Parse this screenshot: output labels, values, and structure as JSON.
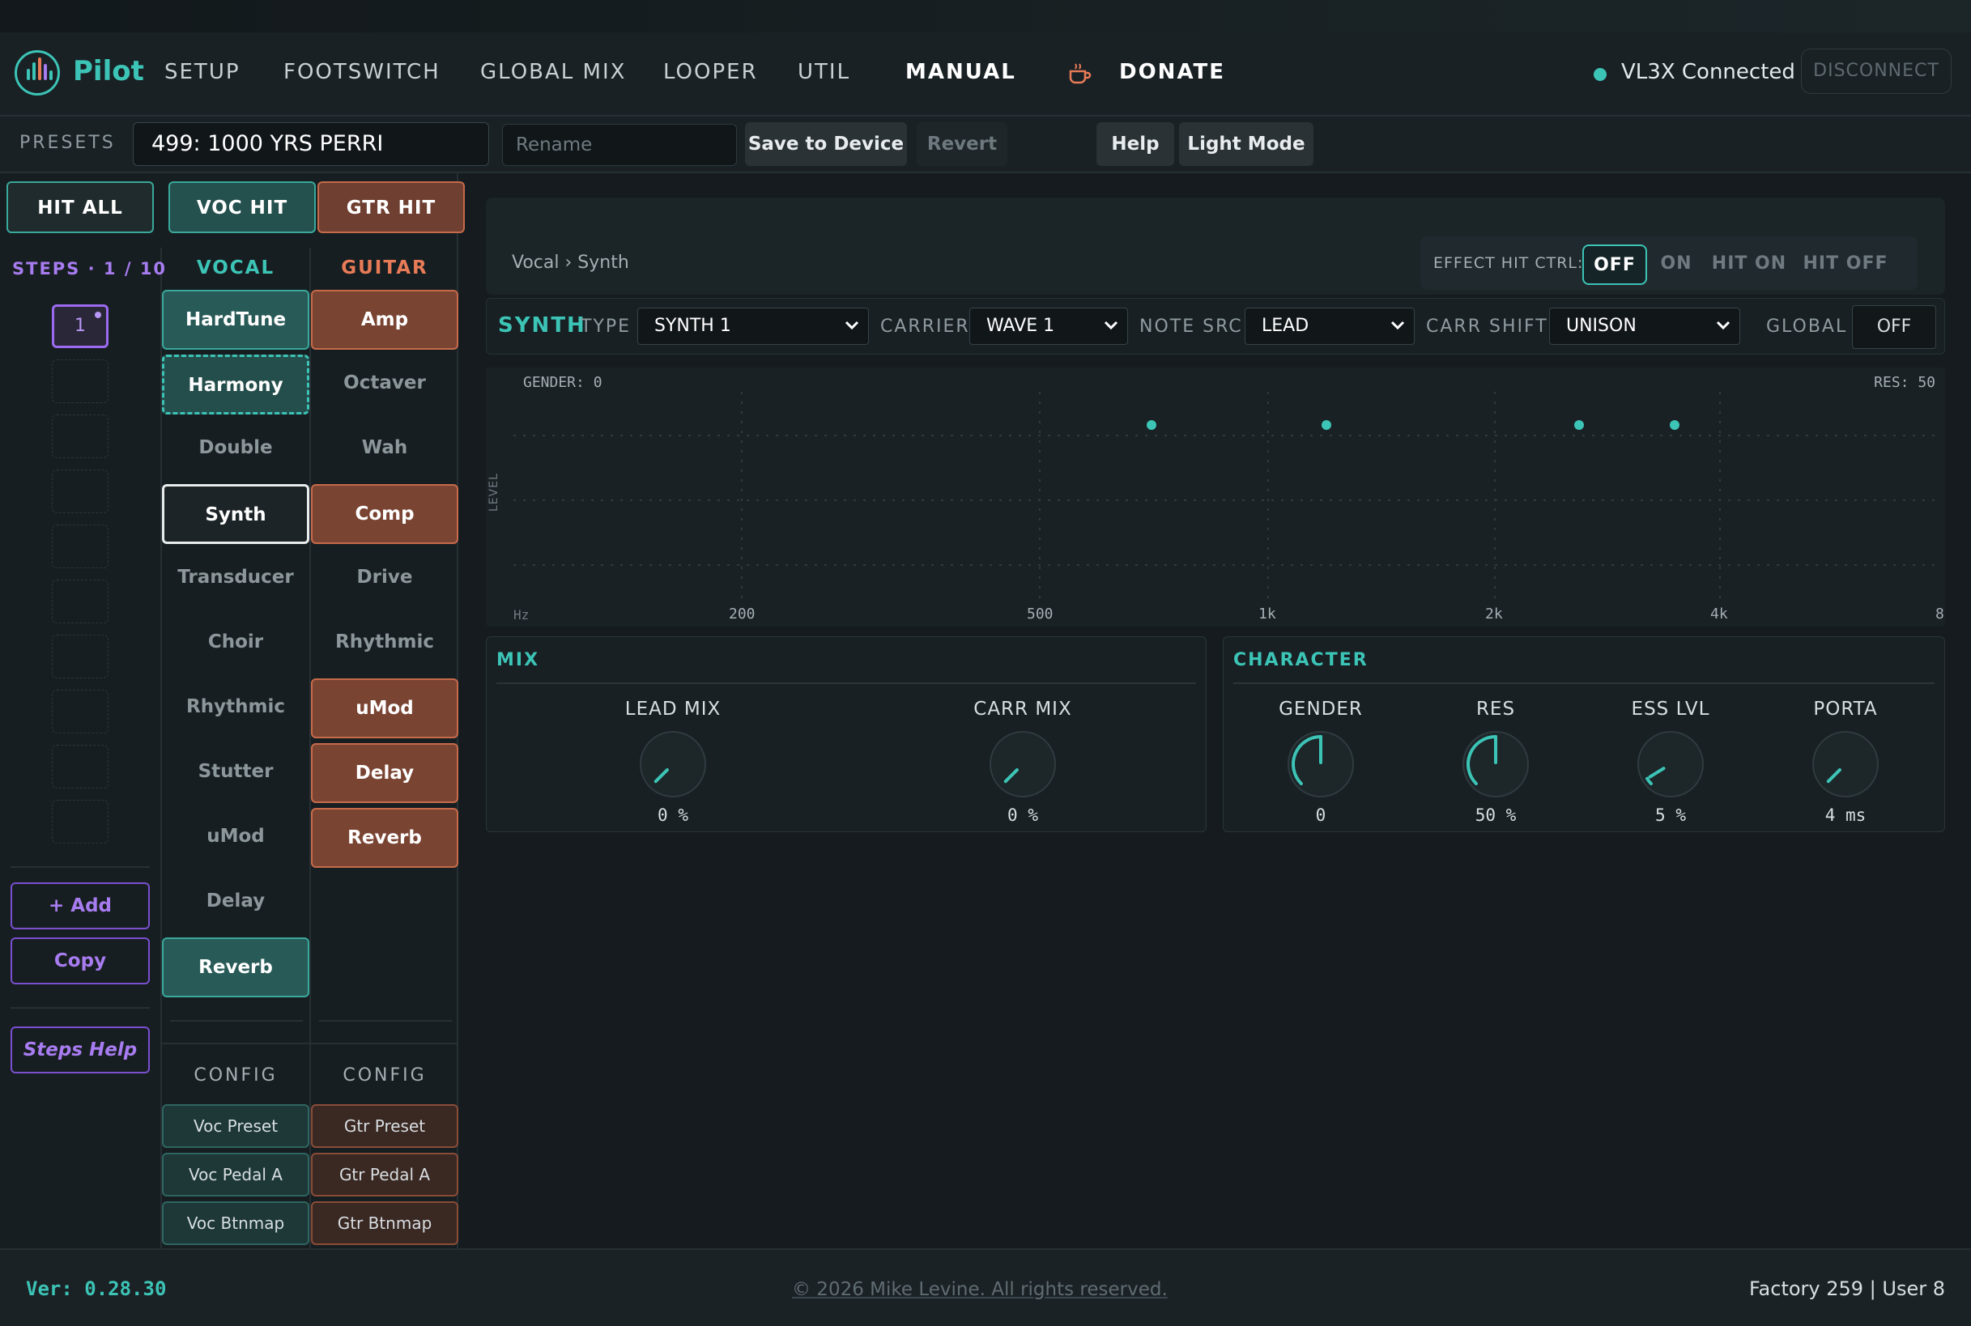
{
  "app": {
    "name": "Pilot",
    "accent": "#3cc4b6"
  },
  "nav": {
    "items": [
      "SETUP",
      "FOOTSWITCH",
      "GLOBAL MIX",
      "LOOPER",
      "UTIL",
      "MANUAL"
    ],
    "active": "MANUAL",
    "donate": "DONATE",
    "connection_status": "VL3X Connected",
    "disconnect": "DISCONNECT"
  },
  "presets": {
    "label": "PRESETS",
    "current": "499: 1000 YRS PERRI",
    "rename_placeholder": "Rename",
    "save": "Save to Device",
    "revert": "Revert",
    "help": "Help",
    "light_mode": "Light Mode"
  },
  "hits": {
    "all": "HIT ALL",
    "voc": "VOC HIT",
    "gtr": "GTR HIT"
  },
  "steps": {
    "label": "STEPS · 1 / 10",
    "current": "1",
    "add": "+ Add",
    "copy": "Copy",
    "help": "Steps Help"
  },
  "vocal": {
    "title": "VOCAL",
    "effects": [
      "HardTune",
      "Harmony",
      "Double",
      "Synth",
      "Transducer",
      "Choir",
      "Rhythmic",
      "Stutter",
      "uMod",
      "Delay",
      "Reverb"
    ],
    "config_title": "CONFIG",
    "config": [
      "Voc Preset",
      "Voc Pedal A",
      "Voc Btnmap"
    ]
  },
  "guitar": {
    "title": "GUITAR",
    "effects": [
      "Amp",
      "Octaver",
      "Wah",
      "Comp",
      "Drive",
      "Rhythmic",
      "uMod",
      "Delay",
      "Reverb"
    ],
    "config_title": "CONFIG",
    "config": [
      "Gtr Preset",
      "Gtr Pedal A",
      "Gtr Btnmap"
    ]
  },
  "main": {
    "breadcrumb": "Vocal › Synth",
    "effect_hit_ctrl": {
      "label": "EFFECT HIT CTRL:",
      "options": [
        "OFF",
        "ON",
        "HIT ON",
        "HIT OFF"
      ],
      "selected": "OFF"
    },
    "synth": {
      "title": "SYNTH",
      "type_label": "TYPE",
      "type": "SYNTH 1",
      "carrier_label": "CARRIER",
      "carrier": "WAVE 1",
      "note_src_label": "NOTE SRC",
      "note_src": "LEAD",
      "carr_shift_label": "CARR SHIFT",
      "carr_shift": "UNISON",
      "global_label": "GLOBAL",
      "global": "OFF"
    },
    "graph": {
      "gender_readout": "GENDER: 0",
      "res_readout": "RES: 50",
      "ylabel": "LEVEL",
      "x_ticks": [
        "Hz",
        "200",
        "500",
        "1k",
        "2k",
        "4k",
        "8"
      ]
    },
    "mix": {
      "title": "MIX",
      "knobs": [
        {
          "label": "LEAD MIX",
          "value": "0 %",
          "level": 0
        },
        {
          "label": "CARR MIX",
          "value": "0 %",
          "level": 0
        }
      ]
    },
    "character": {
      "title": "CHARACTER",
      "knobs": [
        {
          "label": "GENDER",
          "value": "0",
          "level": 0.5
        },
        {
          "label": "RES",
          "value": "50 %",
          "level": 0.5
        },
        {
          "label": "ESS LVL",
          "value": "5 %",
          "level": 0.05
        },
        {
          "label": "PORTA",
          "value": "4 ms",
          "level": 0
        }
      ]
    }
  },
  "footer": {
    "version": "Ver: 0.28.30",
    "copyright": "© 2026 Mike Levine. All rights reserved.",
    "counts": "Factory 259 | User 8"
  }
}
